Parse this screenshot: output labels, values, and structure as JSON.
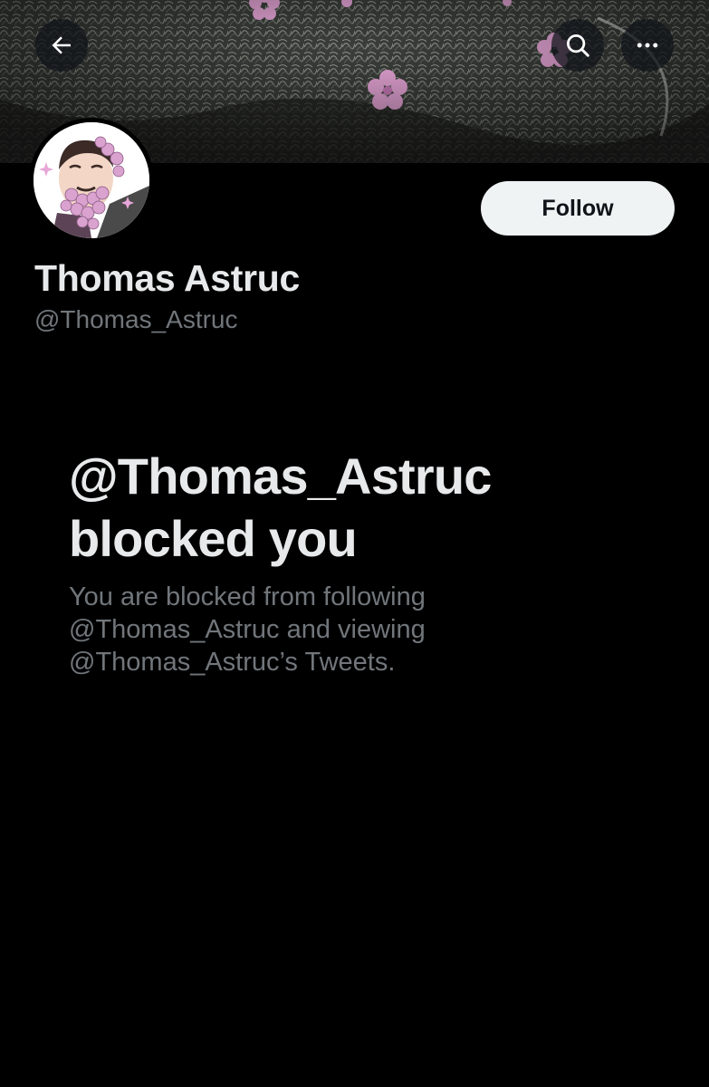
{
  "banner": {
    "image": "profile-banner-moss-with-pink-flowers"
  },
  "nav": {
    "back_icon": "arrow-left-icon",
    "search_icon": "search-icon",
    "more_icon": "more-horizontal-icon"
  },
  "profile": {
    "avatar": "illustrated-avatar-bearded-man-with-flowers",
    "display_name": "Thomas Astruc",
    "handle": "@Thomas_Astruc",
    "follow_label": "Follow"
  },
  "blocked_notice": {
    "title_line1": "@Thomas_Astruc",
    "title_line2": "blocked you",
    "desc_line1": "You are blocked from following",
    "desc_line2": "@Thomas_Astruc and viewing",
    "desc_line3": "@Thomas_Astruc’s Tweets."
  },
  "colors": {
    "background": "#000000",
    "primary_text": "#e7e9ea",
    "secondary_text": "#71767b",
    "follow_button_bg": "#eff3f4",
    "follow_button_text": "#0f1419",
    "flower_pink": "#e7a6d8"
  }
}
